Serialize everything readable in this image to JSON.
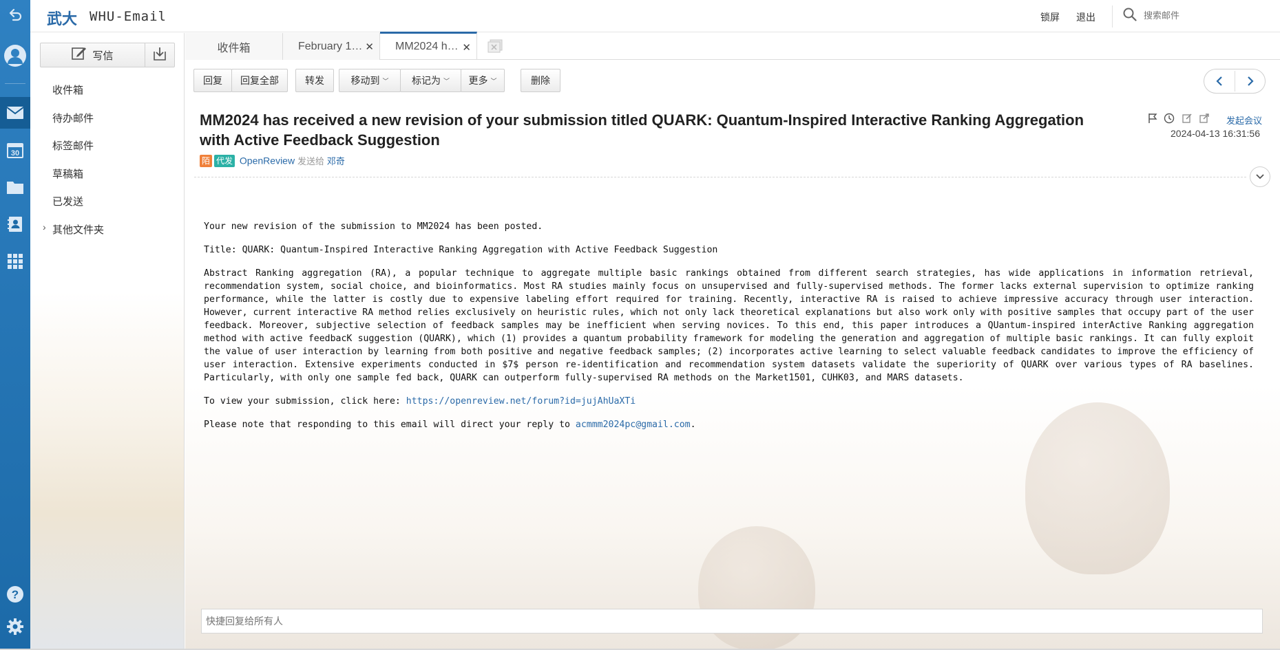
{
  "header": {
    "brand_cn": "武大",
    "brand_en": "WHU-Email",
    "lock_label": "锁屏",
    "logout_label": "退出",
    "search_placeholder": "搜索邮件"
  },
  "sidebar": {
    "compose_label": "写信",
    "folders": [
      {
        "label": "收件箱"
      },
      {
        "label": "待办邮件"
      },
      {
        "label": "标签邮件"
      },
      {
        "label": "草稿箱"
      },
      {
        "label": "已发送"
      },
      {
        "label": "其他文件夹"
      }
    ]
  },
  "tabs": [
    {
      "label": "收件箱"
    },
    {
      "label": "February 1…"
    },
    {
      "label": "MM2024 h…"
    }
  ],
  "toolbar": {
    "reply": "回复",
    "reply_all": "回复全部",
    "forward": "转发",
    "move_to": "移动到",
    "mark_as": "标记为",
    "more": "更多",
    "delete": "删除"
  },
  "mail": {
    "subject": "MM2024 has received a new revision of your submission titled QUARK: Quantum-Inspired Interactive Ranking Aggregation with Active Feedback Suggestion",
    "badge_stranger": "陌",
    "badge_proxy": "代发",
    "sender": "OpenReview",
    "sent_to": "发送给",
    "recipient": "邓奇",
    "meeting": "发起会议",
    "date": "2024-04-13 16:31:56",
    "body": {
      "intro": "Your new revision of the submission to MM2024 has been posted.",
      "title_line": "Title: QUARK: Quantum-Inspired Interactive Ranking Aggregation with Active Feedback Suggestion",
      "abstract": "Abstract Ranking aggregation (RA), a popular technique to aggregate multiple basic rankings obtained from different search strategies, has wide applications in information retrieval, recommendation system, social choice, and bioinformatics. Most RA studies mainly focus on unsupervised and fully-supervised methods. The former lacks external supervision to optimize ranking performance, while the latter is costly due to expensive labeling effort required for training. Recently, interactive RA is raised to achieve impressive accuracy through user interaction. However, current interactive RA method relies exclusively on heuristic rules, which not only lack theoretical explanations but also work only with positive samples that occupy part of the user feedback. Moreover, subjective selection of feedback samples may be inefficient when serving novices. To this end, this paper introduces a QUantum-inspired interActive Ranking aggregation method with active feedbacK suggestion (QUARK), which (1) provides a quantum probability framework for modeling the generation and aggregation of multiple basic rankings. It can fully exploit the value of user interaction by learning from both positive and negative feedback samples; (2) incorporates active learning to select valuable feedback candidates to improve the efficiency of user interaction. Extensive experiments conducted in $7$ person re-identification and recommendation system datasets validate the superiority of QUARK over various types of RA baselines. Particularly, with only one sample fed back, QUARK can outperform fully-supervised RA methods on the Market1501, CUHK03, and MARS datasets.",
      "view_prefix": "To view your submission, click here: ",
      "view_link": "https://openreview.net/forum?id=jujAhUaXTi",
      "note_prefix": "Please note that responding to this email will direct your reply to ",
      "note_email": "acmmm2024pc@gmail.com",
      "note_suffix": "."
    }
  },
  "quick_reply": {
    "placeholder": "快捷回复给所有人"
  },
  "colors": {
    "rail": "#1f6fae",
    "accent": "#2a6aa8",
    "badge_stranger": "#f0803a",
    "badge_proxy": "#2bb1a6"
  }
}
